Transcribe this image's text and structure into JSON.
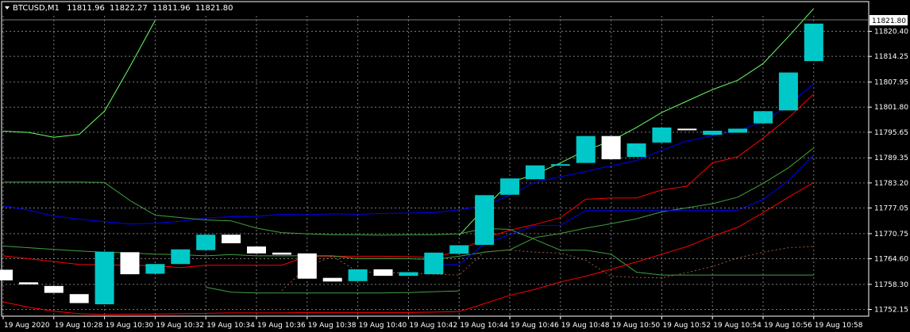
{
  "header": {
    "symbol": "BTCUSD,M1",
    "open": "11811.96",
    "high": "11822.27",
    "low": "11811.96",
    "close": "11821.80"
  },
  "last_price": "11821.80",
  "colors": {
    "background": "#000000",
    "grid": "#7a7a7a",
    "bull_body": "#00c8c8",
    "bear_body": "#ffffff",
    "red": "#ff0000",
    "blue": "#0000ff",
    "green": "#40a040",
    "lime": "#66ff66",
    "dotted": "#a05a3c"
  },
  "chart_data": {
    "type": "candlestick",
    "y_axis_ticks": [
      "11820.40",
      "11814.25",
      "11807.95",
      "11801.80",
      "11795.65",
      "11789.35",
      "11783.20",
      "11777.05",
      "11770.75",
      "11764.60",
      "11758.30",
      "11752.15"
    ],
    "x_axis_ticks": [
      "19 Aug 2020",
      "19 Aug 10:28",
      "19 Aug 10:30",
      "19 Aug 10:32",
      "19 Aug 10:34",
      "19 Aug 10:36",
      "19 Aug 10:38",
      "19 Aug 10:40",
      "19 Aug 10:42",
      "19 Aug 10:44",
      "19 Aug 10:46",
      "19 Aug 10:48",
      "19 Aug 10:50",
      "19 Aug 10:52",
      "19 Aug 10:54",
      "19 Aug 10:56",
      "19 Aug 10:58"
    ],
    "ylim": [
      11750.5,
      11824.2
    ],
    "grid": true,
    "candles": [
      {
        "o": 11761.9,
        "c": 11759.3
      },
      {
        "o": 11758.8,
        "c": 11758.3
      },
      {
        "o": 11757.9,
        "c": 11756.2
      },
      {
        "o": 11755.9,
        "c": 11753.7
      },
      {
        "o": 11753.4,
        "c": 11766.3
      },
      {
        "o": 11766.2,
        "c": 11760.8
      },
      {
        "o": 11760.9,
        "c": 11763.3
      },
      {
        "o": 11763.3,
        "c": 11766.9
      },
      {
        "o": 11766.7,
        "c": 11770.5
      },
      {
        "o": 11770.5,
        "c": 11768.4
      },
      {
        "o": 11767.6,
        "c": 11765.9
      },
      {
        "o": 11766.1,
        "c": 11765.6
      },
      {
        "o": 11765.9,
        "c": 11759.7
      },
      {
        "o": 11759.9,
        "c": 11759.0
      },
      {
        "o": 11759.1,
        "c": 11762.0
      },
      {
        "o": 11762.0,
        "c": 11760.4
      },
      {
        "o": 11760.4,
        "c": 11761.3
      },
      {
        "o": 11760.8,
        "c": 11766.1
      },
      {
        "o": 11765.8,
        "c": 11767.9
      },
      {
        "o": 11768.0,
        "c": 11780.2
      },
      {
        "o": 11780.3,
        "c": 11784.3
      },
      {
        "o": 11784.1,
        "c": 11787.5
      },
      {
        "o": 11787.5,
        "c": 11787.8
      },
      {
        "o": 11788.1,
        "c": 11794.7
      },
      {
        "o": 11794.7,
        "c": 11789.0
      },
      {
        "o": 11789.6,
        "c": 11792.9
      },
      {
        "o": 11793.1,
        "c": 11796.8
      },
      {
        "o": 11796.5,
        "c": 11796.3
      },
      {
        "o": 11795.0,
        "c": 11796.0
      },
      {
        "o": 11795.5,
        "c": 11796.5
      },
      {
        "o": 11797.8,
        "c": 11800.8
      },
      {
        "o": 11801.0,
        "c": 11810.3
      },
      {
        "o": 11813.1,
        "c": 11822.3
      }
    ],
    "lines": [
      {
        "color": "red",
        "values": [
          11765.3,
          11764.6,
          11763.9,
          11763.2,
          11763.1,
          11763.0,
          11762.9,
          11762.4,
          11763.0,
          11763.0,
          11763.0,
          11763.0,
          11765.2,
          11765.2,
          11765.2,
          11765.2,
          11765.1,
          11764.9,
          11766.5,
          11769.6,
          11771.6,
          11773.0,
          11774.7,
          11779.2,
          11779.5,
          11779.5,
          11781.5,
          11782.4,
          11788.1,
          11789.6,
          11794.2,
          11799.2,
          11805.0
        ]
      },
      {
        "color": "blue",
        "values": [
          11777.6,
          11776.5,
          11775.1,
          11774.3,
          11773.7,
          11773.1,
          11773.3,
          11773.8,
          11774.6,
          11774.9,
          11775.0,
          11775.5,
          11775.4,
          11775.6,
          11775.5,
          11775.7,
          11775.8,
          11775.9,
          11776.6,
          11777.6,
          11780.2,
          11783.4,
          11784.7,
          11786.0,
          11787.4,
          11788.7,
          11791.2,
          11793.5,
          11794.8,
          11796.0,
          11798.1,
          11802.4,
          11807.5
        ]
      },
      {
        "color": "lime",
        "values": [
          11795.9,
          11795.6,
          11794.4,
          11795.1,
          11800.8,
          11811.7,
          11823.1,
          null,
          null,
          null,
          null,
          null,
          null,
          null,
          null,
          null,
          null,
          null,
          null,
          null,
          null,
          null,
          null,
          null,
          null,
          null,
          null,
          null,
          null,
          null,
          null,
          null,
          null
        ]
      },
      {
        "color": "lime",
        "values": [
          null,
          null,
          null,
          null,
          null,
          null,
          null,
          null,
          null,
          null,
          null,
          null,
          null,
          null,
          null,
          null,
          null,
          null,
          11770.3,
          11777.0,
          11783.3,
          11785.3,
          11788.1,
          11791.2,
          11793.5,
          11796.8,
          11800.5,
          11803.3,
          11806.1,
          11808.4,
          11812.5,
          11819.1,
          11826.0
        ]
      },
      {
        "color": "green",
        "values": [
          11783.4,
          11783.4,
          11783.4,
          11783.4,
          11783.3,
          11778.9,
          11775.3,
          11774.7,
          11774.1,
          11773.9,
          11772.1,
          11771.0,
          11770.7,
          11770.5,
          11770.5,
          11770.4,
          11770.5,
          11770.5,
          11770.7,
          11772.0,
          11771.8,
          11769.3,
          11766.7,
          11766.7,
          11765.7,
          11761.3,
          11760.6,
          11760.6,
          11760.6,
          11760.6,
          11760.6,
          11760.6,
          11760.6
        ]
      },
      {
        "color": "green",
        "values": [
          11767.7,
          11767.3,
          11766.9,
          11766.5,
          11766.2,
          11766.0,
          11765.7,
          11765.6,
          11765.3,
          11765.6,
          11765.3,
          11765.3,
          11765.3,
          11765.3,
          11764.6,
          11764.6,
          11764.6,
          11764.4,
          11765.2,
          11766.2,
          11766.8,
          11769.8,
          11770.8,
          11772.1,
          11773.2,
          11774.4,
          11776.1,
          11777.1,
          11778.1,
          11779.7,
          11783.1,
          11786.9,
          11791.8
        ]
      },
      {
        "color": "red",
        "values": [
          11754.0,
          11752.7,
          11751.7,
          11751.1,
          11750.9,
          11751.0,
          11751.0,
          11751.1,
          11751.2,
          11751.3,
          11751.3,
          11751.3,
          11751.4,
          11751.4,
          11751.4,
          11751.4,
          11751.4,
          11751.5,
          11751.6,
          11753.6,
          11755.6,
          11757.1,
          11758.9,
          11760.3,
          11762.0,
          11763.8,
          11765.7,
          11767.6,
          11770.1,
          11772.3,
          11775.9,
          11779.7,
          11783.3
        ]
      },
      {
        "color": "green",
        "values": [
          null,
          null,
          null,
          null,
          null,
          null,
          null,
          null,
          11757.6,
          11756.4,
          11756.2,
          11756.2,
          11756.2,
          11756.2,
          11756.2,
          11756.2,
          11756.3,
          11756.5,
          11756.7,
          null,
          null,
          null,
          null,
          null,
          null,
          null,
          null,
          null,
          null,
          null,
          null,
          null,
          null
        ]
      },
      {
        "color": "blue",
        "values": [
          null,
          null,
          null,
          null,
          null,
          null,
          null,
          null,
          null,
          null,
          null,
          null,
          null,
          null,
          null,
          null,
          null,
          11763.1,
          11763.2,
          11768.3,
          11770.5,
          11772.7,
          11772.8,
          11776.4,
          11776.4,
          11776.4,
          11776.4,
          11776.4,
          11776.4,
          11776.5,
          11779.1,
          11783.8,
          11790.1
        ]
      },
      {
        "color": "dotted",
        "values": [
          null,
          null,
          null,
          null,
          null,
          null,
          null,
          null,
          null,
          null,
          null,
          11756.8,
          11762.6,
          11765.2,
          11761.4,
          11761.2,
          11761.1,
          11760.8,
          11760.6,
          11766.3,
          11766.7,
          11766.2,
          11766.0,
          11764.2,
          11760.3,
          11760.0,
          11759.9,
          11761.2,
          11762.7,
          11764.8,
          11766.2,
          11767.3,
          11767.6
        ]
      }
    ]
  }
}
